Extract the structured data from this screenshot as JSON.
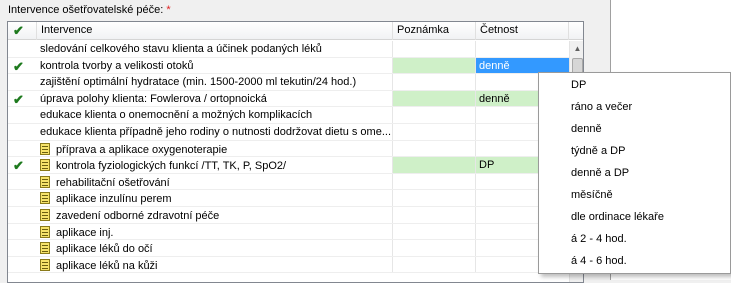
{
  "section": {
    "label": "Intervence ošetřovatelské péče:",
    "required_mark": "*"
  },
  "grid": {
    "header": {
      "check_icon": "✔",
      "intervention": "Intervence",
      "note": "Poznámka",
      "frequency": "Četnost"
    },
    "rows": [
      {
        "checked": false,
        "doc_icon": false,
        "name": "sledování celkového stavu klienta a účinek podaných léků",
        "note": "",
        "frequency": "",
        "green": false,
        "selected": false
      },
      {
        "checked": true,
        "doc_icon": false,
        "name": "kontrola tvorby a velikosti otoků",
        "note": "",
        "frequency": "denně",
        "green": true,
        "selected": true
      },
      {
        "checked": false,
        "doc_icon": false,
        "name": "zajištění optimální hydratace (min. 1500-2000 ml tekutin/24 hod.)",
        "note": "",
        "frequency": "",
        "green": false,
        "selected": false
      },
      {
        "checked": true,
        "doc_icon": false,
        "name": "úprava polohy klienta: Fowlerova / ortopnoická",
        "note": "",
        "frequency": "denně",
        "green": true,
        "selected": false
      },
      {
        "checked": false,
        "doc_icon": false,
        "name": "edukace klienta o onemocnění a možných komplikacích",
        "note": "",
        "frequency": "",
        "green": false,
        "selected": false
      },
      {
        "checked": false,
        "doc_icon": false,
        "name": "edukace klienta případně jeho rodiny o nutnosti dodržovat dietu s ome...",
        "note": "",
        "frequency": "",
        "green": false,
        "selected": false
      },
      {
        "checked": false,
        "doc_icon": true,
        "name": "příprava a aplikace oxygenoterapie",
        "note": "",
        "frequency": "",
        "green": false,
        "selected": false
      },
      {
        "checked": true,
        "doc_icon": true,
        "name": "kontrola fyziologických funkcí /TT, TK, P, SpO2/",
        "note": "",
        "frequency": "DP",
        "green": true,
        "selected": false
      },
      {
        "checked": false,
        "doc_icon": true,
        "name": "rehabilitační ošetřování",
        "note": "",
        "frequency": "",
        "green": false,
        "selected": false
      },
      {
        "checked": false,
        "doc_icon": true,
        "name": "aplikace inzulínu perem",
        "note": "",
        "frequency": "",
        "green": false,
        "selected": false
      },
      {
        "checked": false,
        "doc_icon": true,
        "name": "zavedení odborné zdravotní péče",
        "note": "",
        "frequency": "",
        "green": false,
        "selected": false
      },
      {
        "checked": false,
        "doc_icon": true,
        "name": "aplikace inj.",
        "note": "",
        "frequency": "",
        "green": false,
        "selected": false
      },
      {
        "checked": false,
        "doc_icon": true,
        "name": "aplikace léků  do očí",
        "note": "",
        "frequency": "",
        "green": false,
        "selected": false
      },
      {
        "checked": false,
        "doc_icon": true,
        "name": "aplikace léků  na kůži",
        "note": "",
        "frequency": "",
        "green": false,
        "selected": false
      }
    ]
  },
  "frequency_dropdown": {
    "options": [
      "DP",
      "ráno a večer",
      "denně",
      "týdně a DP",
      "denně a DP",
      "měsíčně",
      "dle ordinace lékaře",
      "á 2 - 4 hod.",
      "á 4 - 6 hod."
    ]
  },
  "icons": {
    "check": "check-icon",
    "document": "document-icon",
    "scroll_up": "scroll-up-arrow-icon"
  },
  "colors": {
    "checked_row_green": "#cff0c8",
    "selection_blue": "#3399ff",
    "required_red": "#e02020",
    "check_green": "#1e7a1e"
  }
}
